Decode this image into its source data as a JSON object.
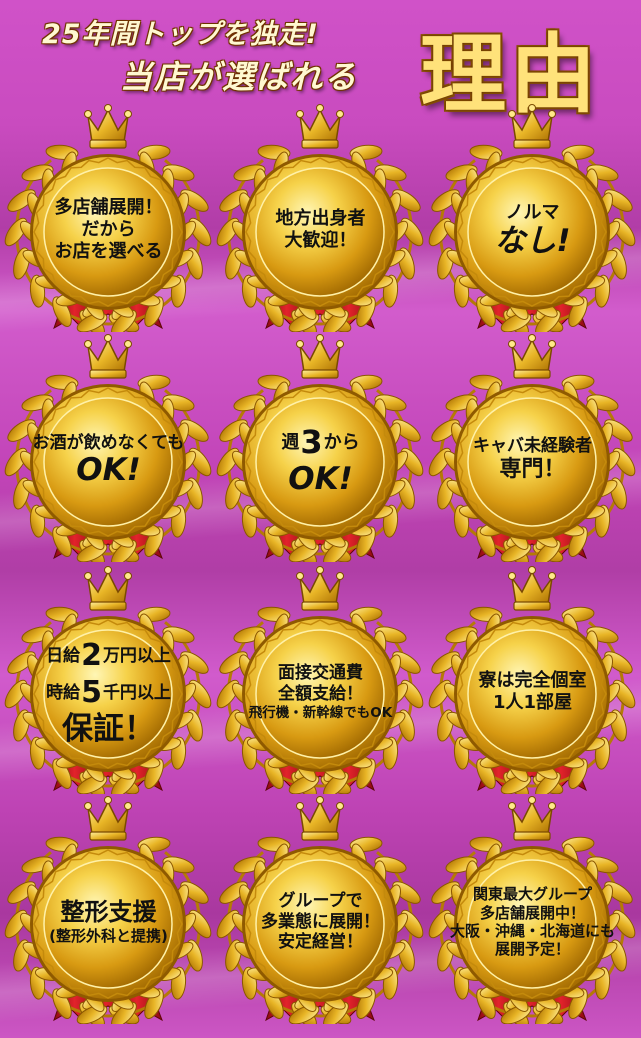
{
  "header": {
    "line1": "25年間トップを独走!",
    "line2": "当店が選ばれる",
    "big": "理由"
  },
  "colors": {
    "background": "#c64bbd",
    "gold": "#e9b928",
    "ribbon": "#c8161d"
  },
  "awards": [
    {
      "line1": "多店舗展開！",
      "line2": "だから",
      "line3": "お店を選べる"
    },
    {
      "line1": "地方出身者",
      "line2": "大歓迎！"
    },
    {
      "line1": "ノルマ",
      "line2": "なし!"
    },
    {
      "line1": "お酒が飲めなくても",
      "line2": "OK!"
    },
    {
      "pre": "週",
      "num": "3",
      "post": "から",
      "line2": "OK!"
    },
    {
      "line1": "キャバ未経験者",
      "line2": "専門！"
    },
    {
      "l1a": "日給",
      "l1num": "2",
      "l1b": "万円以上",
      "l2a": "時給",
      "l2num": "5",
      "l2b": "千円以上",
      "line3": "保証！"
    },
    {
      "line1": "面接交通費",
      "line2": "全額支給！",
      "line3": "飛行機・新幹線でもOK"
    },
    {
      "line1": "寮は完全個室",
      "line2": "1人1部屋"
    },
    {
      "line1": "整形支援",
      "line2": "(整形外科と提携)"
    },
    {
      "line1": "グループで",
      "line2": "多業態に展開！",
      "line3": "安定経営！"
    },
    {
      "line1": "関東最大グループ",
      "line2": "多店舗展開中！",
      "line3": "大阪・沖縄・北海道にも",
      "line4": "展開予定！"
    }
  ]
}
